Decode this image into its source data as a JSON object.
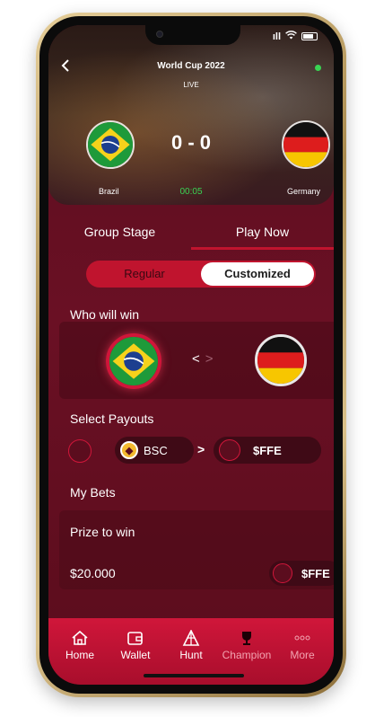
{
  "status_bar": {
    "signal": "ıll"
  },
  "match": {
    "title": "World Cup 2022",
    "status": "LIVE",
    "score": "0 - 0",
    "time": "00:05",
    "team_home": "Brazil",
    "team_away": "Germany"
  },
  "stage_tabs": [
    {
      "label": "Group Stage",
      "active": false
    },
    {
      "label": "Play Now",
      "active": true
    }
  ],
  "mode_toggle": {
    "regular": "Regular",
    "customized": "Customized",
    "selected": "Customized"
  },
  "who_will_win": {
    "label": "Who will win",
    "selected": "Brazil"
  },
  "payouts": {
    "label": "Select Payouts",
    "network": "BSC",
    "token": "$FFE"
  },
  "bets": {
    "label": "My Bets",
    "prize_label": "Prize to win",
    "prize_amount": "$20.000",
    "prize_token": "$FFE"
  },
  "nav": [
    {
      "label": "Home",
      "icon": "home-icon"
    },
    {
      "label": "Wallet",
      "icon": "wallet-icon"
    },
    {
      "label": "Hunt",
      "icon": "hunt-icon"
    },
    {
      "label": "Champion",
      "icon": "trophy-icon"
    },
    {
      "label": "More",
      "icon": "more-icon"
    }
  ],
  "colors": {
    "accent": "#c0142e",
    "background": "#5b0d1e",
    "live": "#39d353"
  }
}
